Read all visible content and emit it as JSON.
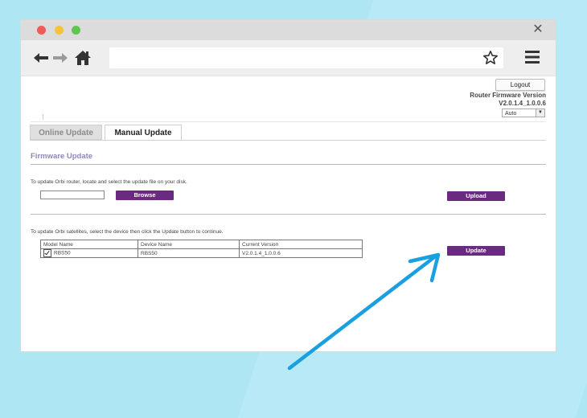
{
  "header": {
    "logout_label": "Logout",
    "fw_label": "Router Firmware Version",
    "fw_value": "V2.0.1.4_1.0.0.6",
    "select_value": "Auto"
  },
  "tabs": {
    "online": "Online Update",
    "manual": "Manual Update"
  },
  "firmware": {
    "title": "Firmware Update",
    "router_instruction": "To update Orbi router, locate and select the update file on your disk.",
    "browse_label": "Browse",
    "upload_label": "Upload",
    "satellite_instruction": "To update Orbi satellites, select the device then click the Update button to continue.",
    "update_label": "Update"
  },
  "table": {
    "headers": [
      "Model Name",
      "Device Name",
      "Current Version"
    ],
    "rows": [
      {
        "model": "RBS50",
        "device": "RBS50",
        "version": "V2.0.1.4_1.0.0.6",
        "checked": true
      }
    ]
  },
  "colors": {
    "accent": "#6b2a82",
    "pointer_arrow": "#1a9fe0",
    "background": "#aee6f4"
  }
}
